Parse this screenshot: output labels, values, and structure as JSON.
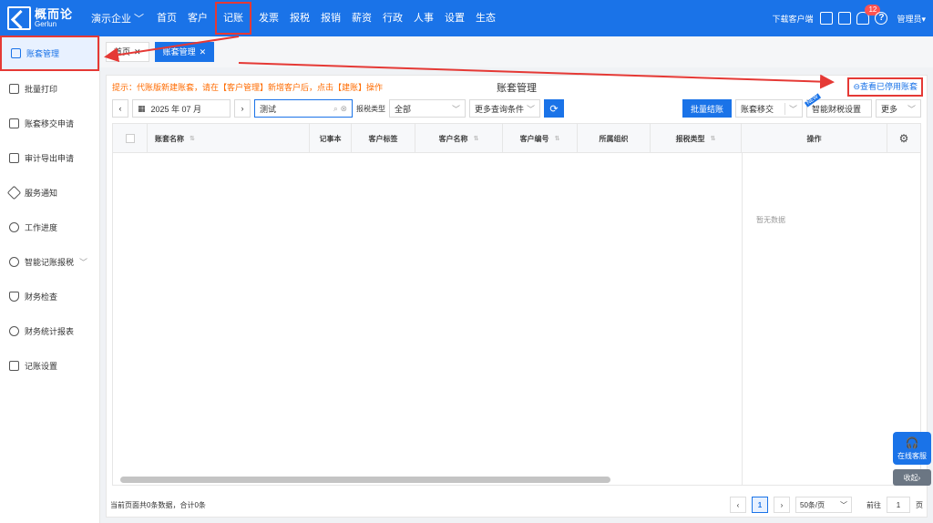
{
  "brand": {
    "cn": "概而论",
    "en": "Gerlun"
  },
  "company": "演示企业",
  "nav": [
    "首页",
    "客户",
    "记账",
    "发票",
    "报税",
    "报销",
    "薪资",
    "行政",
    "人事",
    "设置",
    "生态"
  ],
  "top": {
    "download": "下载客户端",
    "badge": "12",
    "admin": "管理员"
  },
  "sidebar": [
    "账套管理",
    "批量打印",
    "账套移交申请",
    "审计导出申请",
    "服务通知",
    "工作进度",
    "智能记账报税",
    "财务检查",
    "财务统计报表",
    "记账设置"
  ],
  "tabs": [
    "首页",
    "账套管理"
  ],
  "hint": "提示：代账版新建账套，请在【客户管理】新增客户后，点击【建账】操作",
  "page_title": "账套管理",
  "stopped_label": "查看已停用账套",
  "toolbar": {
    "date": "2025 年 07 月",
    "search_value": "测试",
    "tax_type_label": "报税类型",
    "tax_type_value": "全部",
    "more_conditions": "更多查询条件",
    "batch_close": "批量结账",
    "transfer": "账套移交",
    "new_tag": "NEW",
    "smart_settings": "智能财税设置",
    "more": "更多"
  },
  "columns": [
    "账套名称",
    "记事本",
    "客户标签",
    "客户名称",
    "客户编号",
    "所属组织",
    "报税类型",
    "操作"
  ],
  "empty_text": "暂无数据",
  "footer": {
    "summary": "当前页面共0条数据，合计0条",
    "page": "1",
    "page_size": "50条/页",
    "goto": "前往",
    "goto_page": "1",
    "page_unit": "页"
  },
  "float": {
    "service": "在线客服",
    "fold": "收起"
  }
}
